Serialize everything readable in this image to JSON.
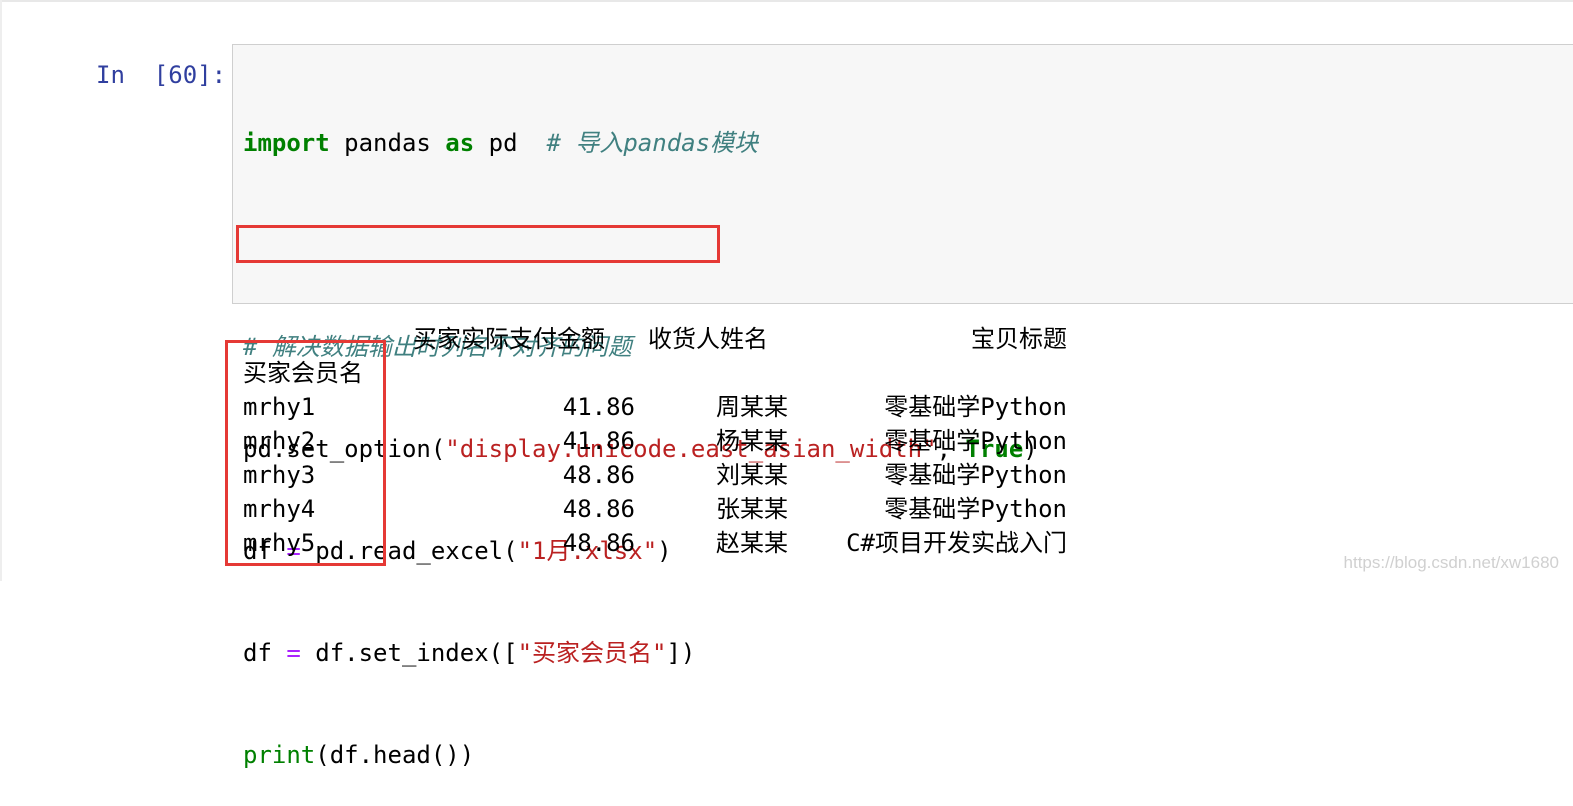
{
  "cell": {
    "prompt": "In  [60]:",
    "code": {
      "line1": {
        "import_kw": "import",
        "module": " pandas ",
        "as_kw": "as",
        "alias": " pd  ",
        "comment": "# 导入pandas模块"
      },
      "line3": {
        "comment": "# 解决数据输出时列名不对齐的问题"
      },
      "line4": {
        "prefix": "pd.set_option(",
        "string": "\"display.unicode.east_asian_width\"",
        "sep": ", ",
        "true_kw": "True",
        "suffix": ")"
      },
      "line5": {
        "var": "df ",
        "eq": "=",
        "call": " pd.read_excel(",
        "string": "\"1月.xlsx\"",
        "suffix": ")"
      },
      "line6": {
        "var": "df ",
        "eq": "=",
        "call": " df.set_index([",
        "string": "\"买家会员名\"",
        "suffix": "])"
      },
      "line7": {
        "builtin": "print",
        "suffix": "(df.head())"
      }
    }
  },
  "output": {
    "headers": {
      "amount": "买家实际支付金额",
      "name": "收货人姓名",
      "title": "宝贝标题"
    },
    "index_name": "买家会员名",
    "rows": [
      {
        "idx": "mrhy1",
        "amount": "41.86",
        "name": "周某某",
        "title": "零基础学Python"
      },
      {
        "idx": "mrhy2",
        "amount": "41.86",
        "name": "杨某某",
        "title": "零基础学Python"
      },
      {
        "idx": "mrhy3",
        "amount": "48.86",
        "name": "刘某某",
        "title": "零基础学Python"
      },
      {
        "idx": "mrhy4",
        "amount": "48.86",
        "name": "张某某",
        "title": "零基础学Python"
      },
      {
        "idx": "mrhy5",
        "amount": "48.86",
        "name": "赵某某",
        "title": "C#项目开发实战入门"
      }
    ]
  },
  "watermark": "https://blog.csdn.net/xw1680",
  "colors": {
    "prompt": "#303f9f",
    "keyword": "#008000",
    "comment": "#408080",
    "string": "#ba2121",
    "operator": "#aa22ff",
    "highlight": "#e53935"
  }
}
